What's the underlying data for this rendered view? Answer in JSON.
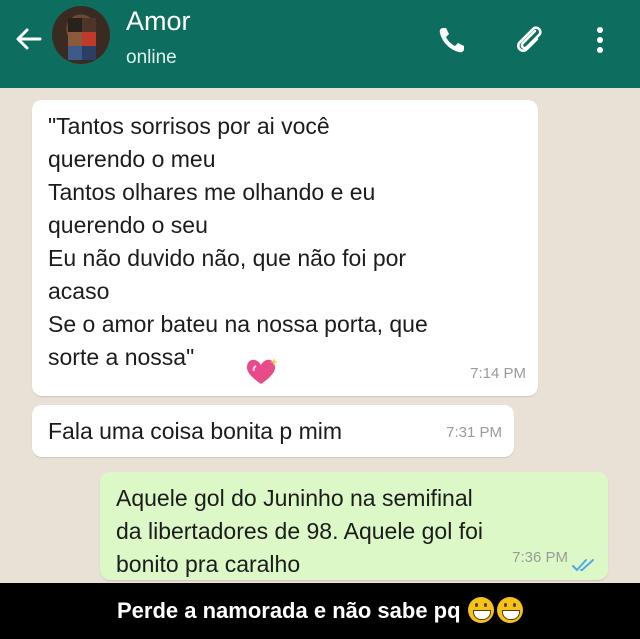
{
  "header": {
    "contact_name": "Amor",
    "status": "online",
    "colors": {
      "bar": "#0d6e5f"
    }
  },
  "icons": {
    "back": "arrow-left-icon",
    "call": "phone-icon",
    "attach": "paperclip-icon",
    "menu": "more-vertical-icon",
    "emoji_heart": "sparkling-heart-icon",
    "double_check": "double-check-icon"
  },
  "messages": [
    {
      "direction": "incoming",
      "text": "\"Tantos sorrisos por ai você\nquerendo o meu\nTantos olhares me olhando e eu\nquerendo o seu\nEu não duvido não, que não foi por\nacaso\nSe o amor bateu na nossa porta, que\nsorte a nossa\"",
      "time": "7:14 PM"
    },
    {
      "direction": "incoming",
      "text": "Fala uma coisa bonita p mim",
      "time": "7:31 PM"
    },
    {
      "direction": "outgoing",
      "text": "Aquele gol do Juninho na semifinal\nda libertadores de 98. Aquele gol foi\nbonito pra caralho",
      "time": "7:36 PM"
    }
  ],
  "caption": {
    "text": "Perde a namorada e não sabe pq"
  }
}
